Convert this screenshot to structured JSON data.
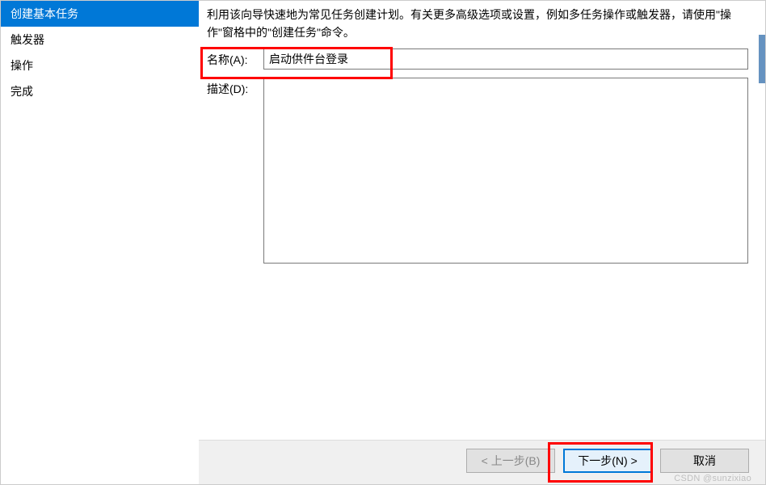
{
  "sidebar": {
    "items": [
      {
        "label": "创建基本任务",
        "active": true
      },
      {
        "label": "触发器",
        "active": false
      },
      {
        "label": "操作",
        "active": false
      },
      {
        "label": "完成",
        "active": false
      }
    ]
  },
  "main": {
    "intro": "利用该向导快速地为常见任务创建计划。有关更多高级选项或设置，例如多任务操作或触发器，请使用\"操作\"窗格中的\"创建任务\"命令。",
    "name_label": "名称(A):",
    "name_value": "启动供件台登录",
    "desc_label": "描述(D):",
    "desc_value": ""
  },
  "buttons": {
    "back": "< 上一步(B)",
    "next": "下一步(N) >",
    "cancel": "取消"
  },
  "watermark": "CSDN @sunzixiao"
}
